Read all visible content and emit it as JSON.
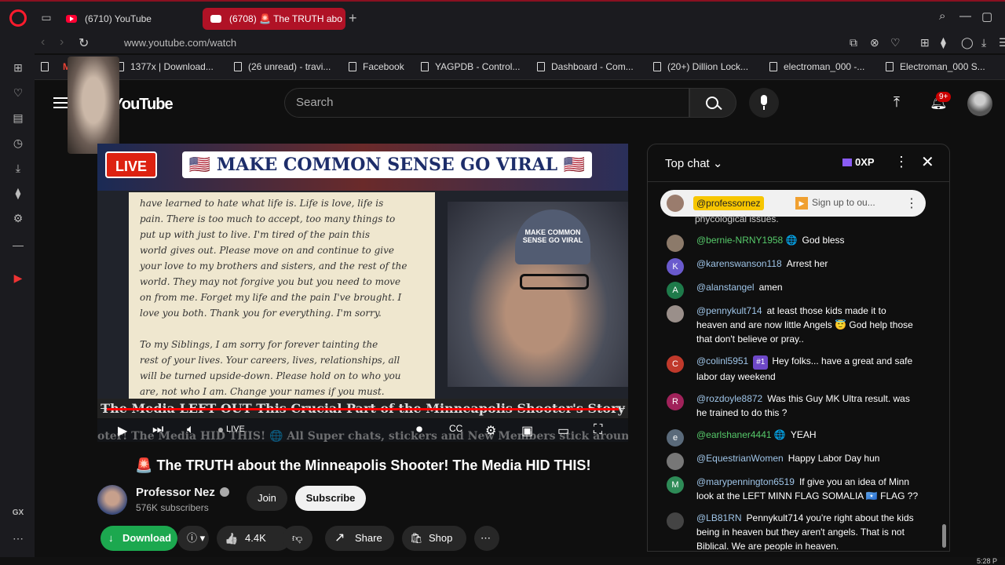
{
  "browser": {
    "tabs": [
      {
        "label": "(6710) YouTube"
      },
      {
        "label": "(6708) 🚨 The TRUTH abo"
      }
    ],
    "url": "www.youtube.com/watch",
    "bookmarks": [
      "1377x | Download...",
      "(26 unread) - travi...",
      "Facebook",
      "YAGPDB - Control...",
      "Dashboard - Com...",
      "(20+) Dillion Lock...",
      "electroman_000 -...",
      "Electroman_000 S..."
    ],
    "sidebar_label": "GX"
  },
  "youtube": {
    "logo": "YouTube",
    "search_placeholder": "Search",
    "notification_count": "9+"
  },
  "video": {
    "live_label": "LIVE",
    "banner_text": "🇺🇸 MAKE COMMON SENSE GO VIRAL 🇺🇸",
    "letter_text": "have learned to hate what life is. Life is love, life is\npain. There is too much to accept, too many things to\nput up with just to live. I'm tired of the pain this\nworld gives out. Please move on and continue to give\nyour love to my brothers and sisters, and the rest of the\nworld. They may not forgive you but you need to move\non from me. Forget my life and the pain I've brought. I\nlove you both. Thank you for everything. I'm sorry.\n\nTo my Siblings, I am sorry for forever tainting the\nrest of your lives. Your careers, lives, relationships, all\nwill be turned upside-down. Please hold on to who you\nare, not who I am. Change your names if you must.",
    "hat_text": "MAKE COMMON SENSE GO VIRAL",
    "headline": "The Media LEFT OUT This Crucial Part of the Minneapolis Shooter's Story",
    "live_indicator": "LIVE",
    "ticker": "oter! The Media HID THIS! 🌐 All Super chats, stickers and New Members stick around",
    "title": "The TRUTH about the Minneapolis Shooter! The Media HID THIS!",
    "title_icon": "🚨"
  },
  "channel": {
    "name": "Professor Nez",
    "subscribers": "576K subscribers",
    "join_label": "Join",
    "subscribe_label": "Subscribe"
  },
  "actions": {
    "download_label": "Download",
    "like_count": "4.4K",
    "share_label": "Share",
    "shop_label": "Shop"
  },
  "chat": {
    "title": "Top chat",
    "xp": "0XP",
    "pinned_user": "@professornez",
    "pinned_text": "Sign up to ou...",
    "partial_line": "phycological issues.",
    "messages": [
      {
        "user": "@bernie-NRNY1958 🌐",
        "text": "God bless",
        "initial": "",
        "color": "#8c7a6a",
        "green": true
      },
      {
        "user": "@karenswanson118",
        "text": "Arrest her",
        "initial": "K",
        "color": "#6a5acd",
        "green": false
      },
      {
        "user": "@alanstangel",
        "text": "amen",
        "initial": "A",
        "color": "#1e7a4a",
        "green": false
      },
      {
        "user": "@pennykult714",
        "text": "at least those kids made it to heaven and are now little Angels 😇 God help those that don't believe or pray..",
        "initial": "",
        "color": "#9a8f8a",
        "green": false
      },
      {
        "user": "@colinl5951",
        "text": "Hey folks... have a great and safe labor day weekend",
        "initial": "C",
        "color": "#c0392b",
        "green": false,
        "badge": "#1"
      },
      {
        "user": "@rozdoyle8872",
        "text": "Was this Guy MK Ultra result. was he trained to do this ?",
        "initial": "R",
        "color": "#a0225a",
        "green": false
      },
      {
        "user": "@earlshaner4441 🌐",
        "text": "YEAH",
        "initial": "e",
        "color": "#5a6a7a",
        "green": true
      },
      {
        "user": "@EquestrianWomen",
        "text": "Happy Labor Day hun",
        "initial": "",
        "color": "#777",
        "green": false
      },
      {
        "user": "@marypennington6519",
        "text": "If give you an idea of Minn look at the LEFT MINN FLAG SOMALIA 🇸🇴 FLAG ??",
        "initial": "M",
        "color": "#2e8b57",
        "green": false
      },
      {
        "user": "@LB81RN",
        "text": "Pennykult714 you're right about the kids being in heaven but they aren't angels. That is not Biblical. We are people in heaven.",
        "initial": "",
        "color": "#444",
        "green": false
      }
    ]
  },
  "clock": "5:28 P"
}
